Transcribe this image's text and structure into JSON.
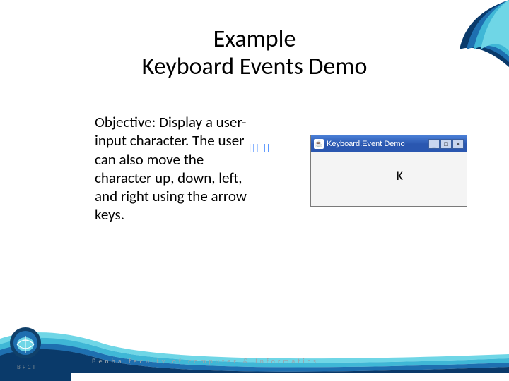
{
  "slide": {
    "title_line1": "Example",
    "title_line2": "Keyboard Events Demo",
    "body": "Objective: Display a user-input character. The user can also move the character up, down, left, and right using the arrow keys."
  },
  "app_window": {
    "icon_glyph": "☕",
    "title": "Keyboard.Event Demo",
    "buttons": {
      "min": "_",
      "max": "□",
      "close": "×"
    },
    "displayed_char": "K"
  },
  "selection_mark": "|||\n||",
  "footer": {
    "bfci": "BFCI",
    "text": "Benha faculty of computer & Informatics"
  },
  "colors": {
    "swoosh_dark": "#0a3a6a",
    "swoosh_mid": "#1e6fb0",
    "swoosh_light": "#3fb7d6",
    "swoosh_accent": "#6fd6e6"
  }
}
